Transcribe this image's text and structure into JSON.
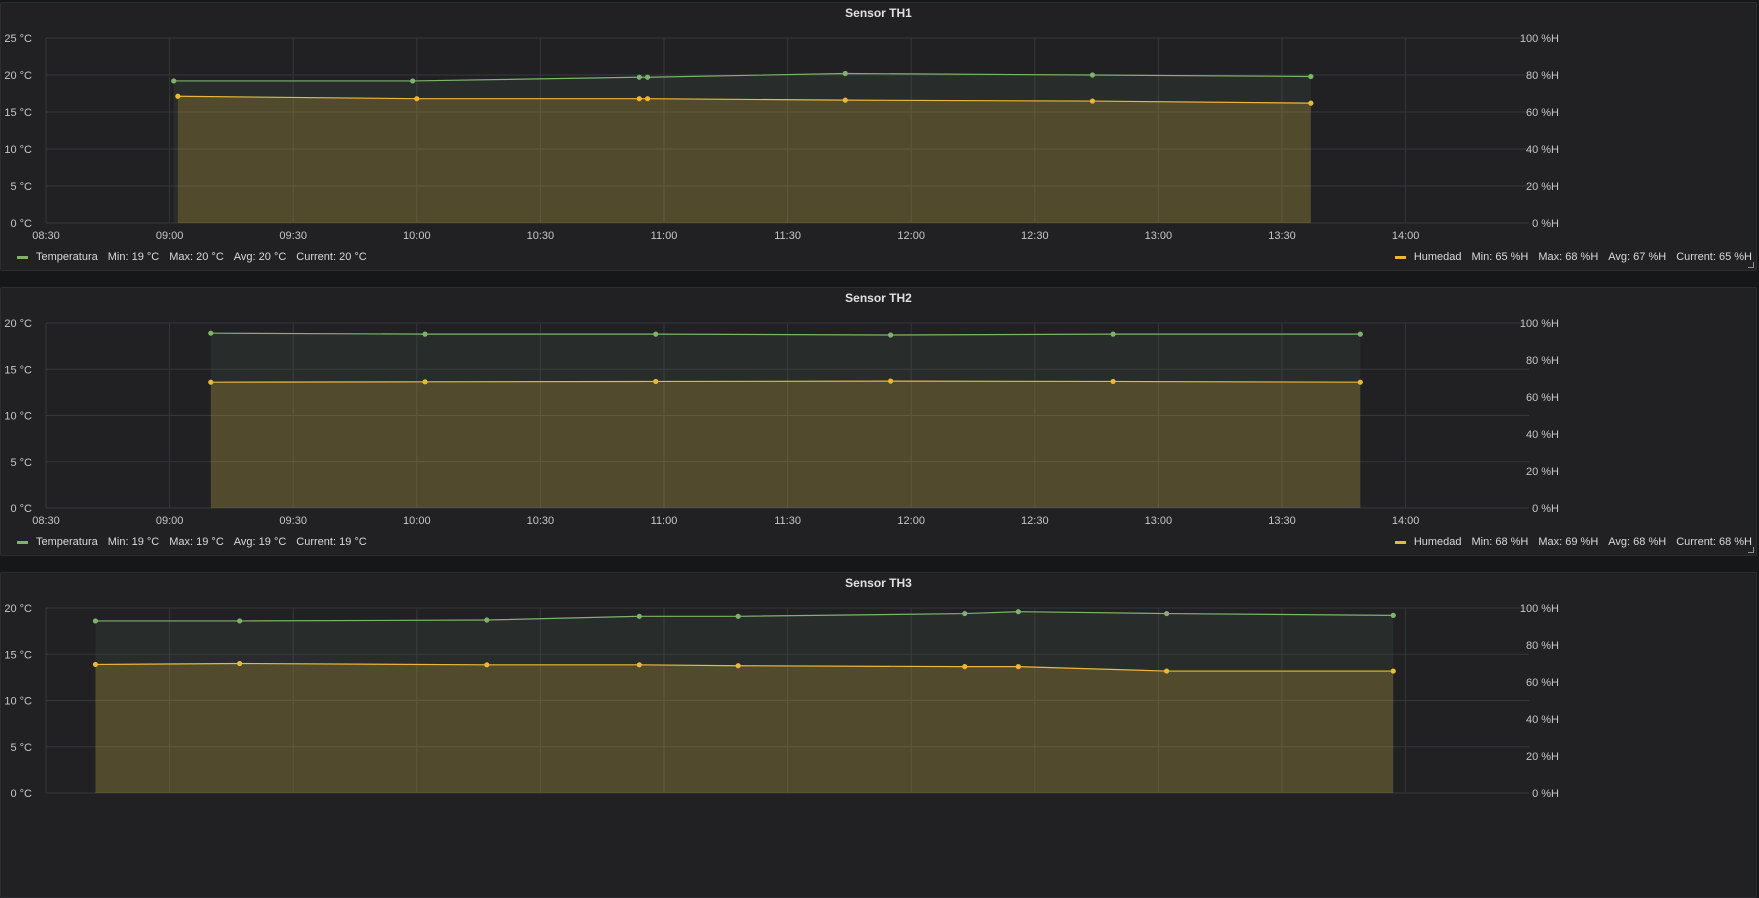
{
  "colors": {
    "temperature": "#7eb26d",
    "humidity": "#eab839"
  },
  "chart_data": [
    {
      "type": "line",
      "title": "Sensor TH1",
      "x_ticks": [
        "08:30",
        "09:00",
        "09:30",
        "10:00",
        "10:30",
        "11:00",
        "11:30",
        "12:00",
        "12:30",
        "13:00",
        "13:30",
        "14:00"
      ],
      "y_left_ticks": [
        "0 °C",
        "5 °C",
        "10 °C",
        "15 °C",
        "20 °C",
        "25 °C"
      ],
      "y_right_ticks": [
        "0 %H",
        "20 %H",
        "40 %H",
        "60 %H",
        "80 %H",
        "100 %H"
      ],
      "ylim_left": [
        0,
        25
      ],
      "ylim_right": [
        0,
        100
      ],
      "series": [
        {
          "name": "Temperatura",
          "axis": "left",
          "x": [
            "09:01",
            "09:59",
            "10:54",
            "10:56",
            "11:44",
            "12:44",
            "13:37"
          ],
          "y": [
            19.2,
            19.2,
            19.7,
            19.7,
            20.2,
            20.0,
            19.8
          ]
        },
        {
          "name": "Humedad",
          "axis": "right",
          "x": [
            "09:02",
            "10:00",
            "10:54",
            "10:56",
            "11:44",
            "12:44",
            "13:37"
          ],
          "y": [
            68.5,
            67.2,
            67.2,
            67.2,
            66.4,
            65.9,
            64.8
          ]
        }
      ],
      "legend": {
        "left": {
          "name": "Temperatura",
          "min": "Min: 19 °C",
          "max": "Max: 20 °C",
          "avg": "Avg: 20 °C",
          "current": "Current: 20 °C"
        },
        "right": {
          "name": "Humedad",
          "min": "Min: 65 %H",
          "max": "Max: 68 %H",
          "avg": "Avg: 67 %H",
          "current": "Current: 65 %H"
        }
      }
    },
    {
      "type": "line",
      "title": "Sensor TH2",
      "x_ticks": [
        "08:30",
        "09:00",
        "09:30",
        "10:00",
        "10:30",
        "11:00",
        "11:30",
        "12:00",
        "12:30",
        "13:00",
        "13:30",
        "14:00"
      ],
      "y_left_ticks": [
        "0 °C",
        "5 °C",
        "10 °C",
        "15 °C",
        "20 °C"
      ],
      "y_right_ticks": [
        "0 %H",
        "20 %H",
        "40 %H",
        "60 %H",
        "80 %H",
        "100 %H"
      ],
      "ylim_left": [
        0,
        20
      ],
      "ylim_right": [
        0,
        100
      ],
      "series": [
        {
          "name": "Temperatura",
          "axis": "left",
          "x": [
            "09:10",
            "10:02",
            "10:58",
            "11:55",
            "12:49",
            "13:49"
          ],
          "y": [
            18.9,
            18.8,
            18.8,
            18.7,
            18.8,
            18.8
          ]
        },
        {
          "name": "Humedad",
          "axis": "right",
          "x": [
            "09:10",
            "10:02",
            "10:58",
            "11:55",
            "12:49",
            "13:49"
          ],
          "y": [
            68.0,
            68.2,
            68.4,
            68.6,
            68.4,
            68.0
          ]
        }
      ],
      "legend": {
        "left": {
          "name": "Temperatura",
          "min": "Min: 19 °C",
          "max": "Max: 19 °C",
          "avg": "Avg: 19 °C",
          "current": "Current: 19 °C"
        },
        "right": {
          "name": "Humedad",
          "min": "Min: 68 %H",
          "max": "Max: 69 %H",
          "avg": "Avg: 68 %H",
          "current": "Current: 68 %H"
        }
      }
    },
    {
      "type": "line",
      "title": "Sensor TH3",
      "x_ticks": [
        "08:30",
        "09:00",
        "09:30",
        "10:00",
        "10:30",
        "11:00",
        "11:30",
        "12:00",
        "12:30",
        "13:00",
        "13:30",
        "14:00"
      ],
      "y_left_ticks": [
        "0 °C",
        "5 °C",
        "10 °C",
        "15 °C",
        "20 °C"
      ],
      "y_right_ticks": [
        "0 %H",
        "20 %H",
        "40 %H",
        "60 %H",
        "80 %H",
        "100 %H"
      ],
      "ylim_left": [
        0,
        20
      ],
      "ylim_right": [
        0,
        100
      ],
      "series": [
        {
          "name": "Temperatura",
          "axis": "left",
          "x": [
            "08:42",
            "09:17",
            "10:17",
            "10:54",
            "11:18",
            "12:13",
            "12:26",
            "13:02",
            "13:57"
          ],
          "y": [
            18.6,
            18.6,
            18.7,
            19.1,
            19.1,
            19.4,
            19.6,
            19.4,
            19.2
          ]
        },
        {
          "name": "Humedad",
          "axis": "right",
          "x": [
            "08:42",
            "09:17",
            "10:17",
            "10:54",
            "11:18",
            "12:13",
            "12:26",
            "13:02",
            "13:57"
          ],
          "y": [
            69.5,
            70.0,
            69.3,
            69.3,
            68.8,
            68.3,
            68.3,
            65.9,
            65.9
          ]
        }
      ]
    }
  ]
}
